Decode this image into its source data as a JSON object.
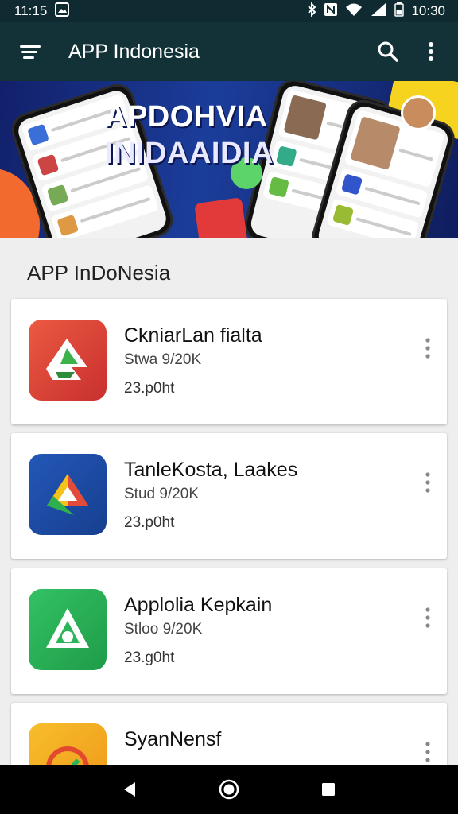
{
  "status_bar": {
    "time_left": "11:15",
    "time_right": "10:30",
    "icons": [
      "image-icon",
      "bluetooth-icon",
      "nfc-icon",
      "wifi-icon",
      "signal-icon",
      "battery-icon"
    ]
  },
  "app_bar": {
    "title": "APP Indonesia",
    "icons": [
      "menu-icon",
      "search-icon",
      "more-vert-icon"
    ]
  },
  "banner": {
    "headline_line1": "APDOHVIA",
    "headline_line2": "INIDAAIDIA"
  },
  "section": {
    "title": "APP InDoNesia"
  },
  "apps": [
    {
      "name": "CkniarLan fialta",
      "sub": "Stwa 9/20K",
      "size": "23.p0ht",
      "icon_colors": [
        "#e8453c",
        "#c62d2d"
      ]
    },
    {
      "name": "TanleKosta, Laakes",
      "sub": "Stud 9/20K",
      "size": "23.p0ht",
      "icon_colors": [
        "#1e4fa8",
        "#163a86"
      ]
    },
    {
      "name": "Applolia Kepkain",
      "sub": "Stloo 9/20K",
      "size": "23.g0ht",
      "icon_colors": [
        "#2bb55a",
        "#1f9a48"
      ]
    },
    {
      "name": "SyanNensf",
      "sub": "",
      "size": "",
      "icon_colors": [
        "#f5b321",
        "#f09a1c"
      ]
    }
  ],
  "nav_bar": {
    "icons": [
      "back-icon",
      "home-icon",
      "recents-icon"
    ]
  }
}
